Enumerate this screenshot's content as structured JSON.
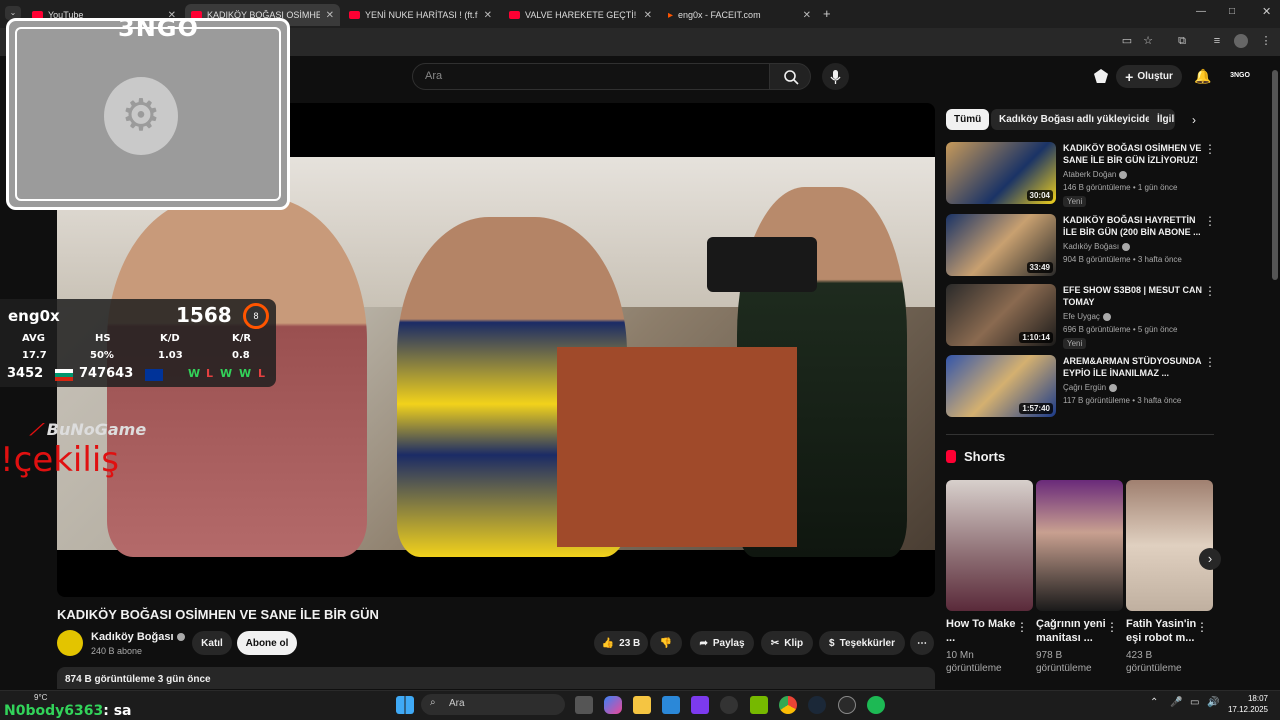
{
  "tabs": [
    {
      "label": "YouTube",
      "active": false
    },
    {
      "label": "KADIKÖY BOĞASI OSİMHEN VE",
      "active": true
    },
    {
      "label": "YENİ NUKE HARİTASI ! (ft.fifine",
      "active": false
    },
    {
      "label": "VALVE HAREKETE GEÇTİ! ANUB",
      "active": false
    },
    {
      "label": "eng0x - FACEIT.com",
      "active": false
    }
  ],
  "header": {
    "search_placeholder": "Ara",
    "create_label": "Oluştur"
  },
  "overlay": {
    "cam_logo": "3NGO",
    "faceit": {
      "nickname": "eng0x",
      "elo": "1568",
      "level": "8",
      "stat_labels": [
        "AVG",
        "HS",
        "K/D",
        "K/R"
      ],
      "stat_values": [
        "17.7",
        "50%",
        "1.03",
        "0.8"
      ],
      "rank_country": "3452",
      "rank_region": "747643",
      "recent": [
        "W",
        "L",
        "W",
        "W",
        "L"
      ]
    },
    "brand": "BuNoGame",
    "giveaway": "!çekiliş",
    "chat_user": "N0body6363",
    "chat_msg": ": sa"
  },
  "video": {
    "title": "KADIKÖY BOĞASI OSİMHEN VE SANE İLE BİR GÜN",
    "channel": "Kadıköy Boğası",
    "subscribers": "240 B abone",
    "join_label": "Katıl",
    "subscribe_label": "Abone ol",
    "likes": "23 B",
    "share_label": "Paylaş",
    "clip_label": "Klip",
    "thanks_label": "Teşekkürler",
    "views_date": "874 B görüntüleme  3 gün önce"
  },
  "sidebar": {
    "chips": [
      "Tümü",
      "Kadıköy Boğası adlı yükleyiciden",
      "İlgili"
    ],
    "recommendations": [
      {
        "title": "KADIKÖY BOĞASI OSİMHEN VE SANE İLE BİR GÜN İZLİYORUZ!",
        "channel": "Ataberk Doğan",
        "meta": "146 B görüntüleme • 1 gün önce",
        "badge": "Yeni",
        "duration": "30:04"
      },
      {
        "title": "KADIKÖY BOĞASI HAYRETTİN İLE BİR GÜN (200 BİN ABONE ...",
        "channel": "Kadıköy Boğası",
        "meta": "904 B görüntüleme • 3 hafta önce",
        "badge": "",
        "duration": "33:49"
      },
      {
        "title": "EFE SHOW S3B08 | MESUT CAN TOMAY",
        "channel": "Efe Uygaç",
        "meta": "696 B görüntüleme • 5 gün önce",
        "badge": "Yeni",
        "duration": "1:10:14"
      },
      {
        "title": "AREM&ARMAN STÜDYOSUNDA EYPİO İLE İNANILMAZ ...",
        "channel": "Çağrı Ergün",
        "meta": "117 B görüntüleme • 3 hafta önce",
        "badge": "",
        "duration": "1:57:40"
      }
    ],
    "shorts_heading": "Shorts",
    "shorts": [
      {
        "title": "How To Make ...",
        "views": "10 Mn görüntüleme"
      },
      {
        "title": "Çağrının yeni manitası ...",
        "views": "978 B görüntüleme"
      },
      {
        "title": "Fatih Yasin'in eşi robot m...",
        "views": "423 B görüntüleme"
      }
    ]
  },
  "taskbar": {
    "weather": "9°C",
    "search_label": "Ara",
    "time": "18:07",
    "date": "17.12.2025"
  },
  "colors": {
    "accent": "#ff0033",
    "bg": "#0f0f0f",
    "faceit": "#ff5500"
  }
}
